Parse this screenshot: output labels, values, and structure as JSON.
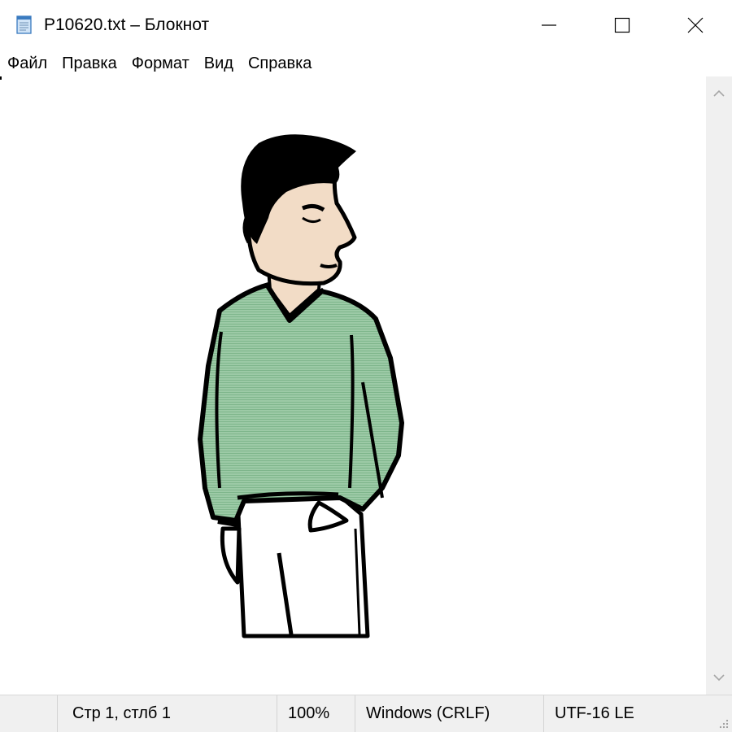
{
  "window": {
    "title": "P10620.txt – Блокнот",
    "icon": "notepad-icon",
    "controls": [
      "minimize-icon",
      "maximize-icon",
      "close-icon"
    ]
  },
  "menu": {
    "items": [
      {
        "label": "Файл"
      },
      {
        "label": "Правка"
      },
      {
        "label": "Формат"
      },
      {
        "label": "Вид"
      },
      {
        "label": "Справка"
      }
    ]
  },
  "editor": {
    "content_image": "man-in-green-sweater-illustration",
    "colors": {
      "sweater": "#8fc19a",
      "skin": "#f2dcc6",
      "hair": "#000000",
      "pants": "#ffffff"
    }
  },
  "status": {
    "position": "Стр 1, стлб 1",
    "zoom": "100%",
    "line_endings": "Windows (CRLF)",
    "encoding": "UTF-16 LE"
  }
}
